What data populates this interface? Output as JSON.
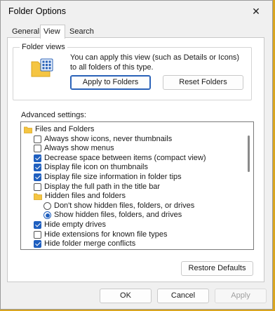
{
  "window": {
    "title": "Folder Options",
    "close_symbol": "✕"
  },
  "tabs": [
    "General",
    "View",
    "Search"
  ],
  "folder_views": {
    "title": "Folder views",
    "description": "You can apply this view (such as Details or Icons) to all folders of this type.",
    "apply_button": "Apply to Folders",
    "reset_button": "Reset Folders"
  },
  "advanced": {
    "label": "Advanced settings:",
    "items": [
      {
        "type": "folder",
        "label": "Files and Folders"
      },
      {
        "type": "checkbox",
        "checked": false,
        "label": "Always show icons, never thumbnails"
      },
      {
        "type": "checkbox",
        "checked": false,
        "label": "Always show menus"
      },
      {
        "type": "checkbox",
        "checked": true,
        "label": "Decrease space between items (compact view)"
      },
      {
        "type": "checkbox",
        "checked": true,
        "label": "Display file icon on thumbnails"
      },
      {
        "type": "checkbox",
        "checked": true,
        "label": "Display file size information in folder tips"
      },
      {
        "type": "checkbox",
        "checked": false,
        "label": "Display the full path in the title bar"
      },
      {
        "type": "folder",
        "label": "Hidden files and folders"
      },
      {
        "type": "radio",
        "checked": false,
        "label": "Don't show hidden files, folders, or drives"
      },
      {
        "type": "radio",
        "checked": true,
        "label": "Show hidden files, folders, and drives"
      },
      {
        "type": "checkbox",
        "checked": true,
        "label": "Hide empty drives"
      },
      {
        "type": "checkbox",
        "checked": false,
        "label": "Hide extensions for known file types"
      },
      {
        "type": "checkbox",
        "checked": true,
        "label": "Hide folder merge conflicts"
      }
    ]
  },
  "restore_button": "Restore Defaults",
  "footer": {
    "ok": "OK",
    "cancel": "Cancel",
    "apply": "Apply"
  },
  "colors": {
    "accent": "#1f5fbf",
    "folder": "#f5c542",
    "taskbar": "#d9a520"
  }
}
